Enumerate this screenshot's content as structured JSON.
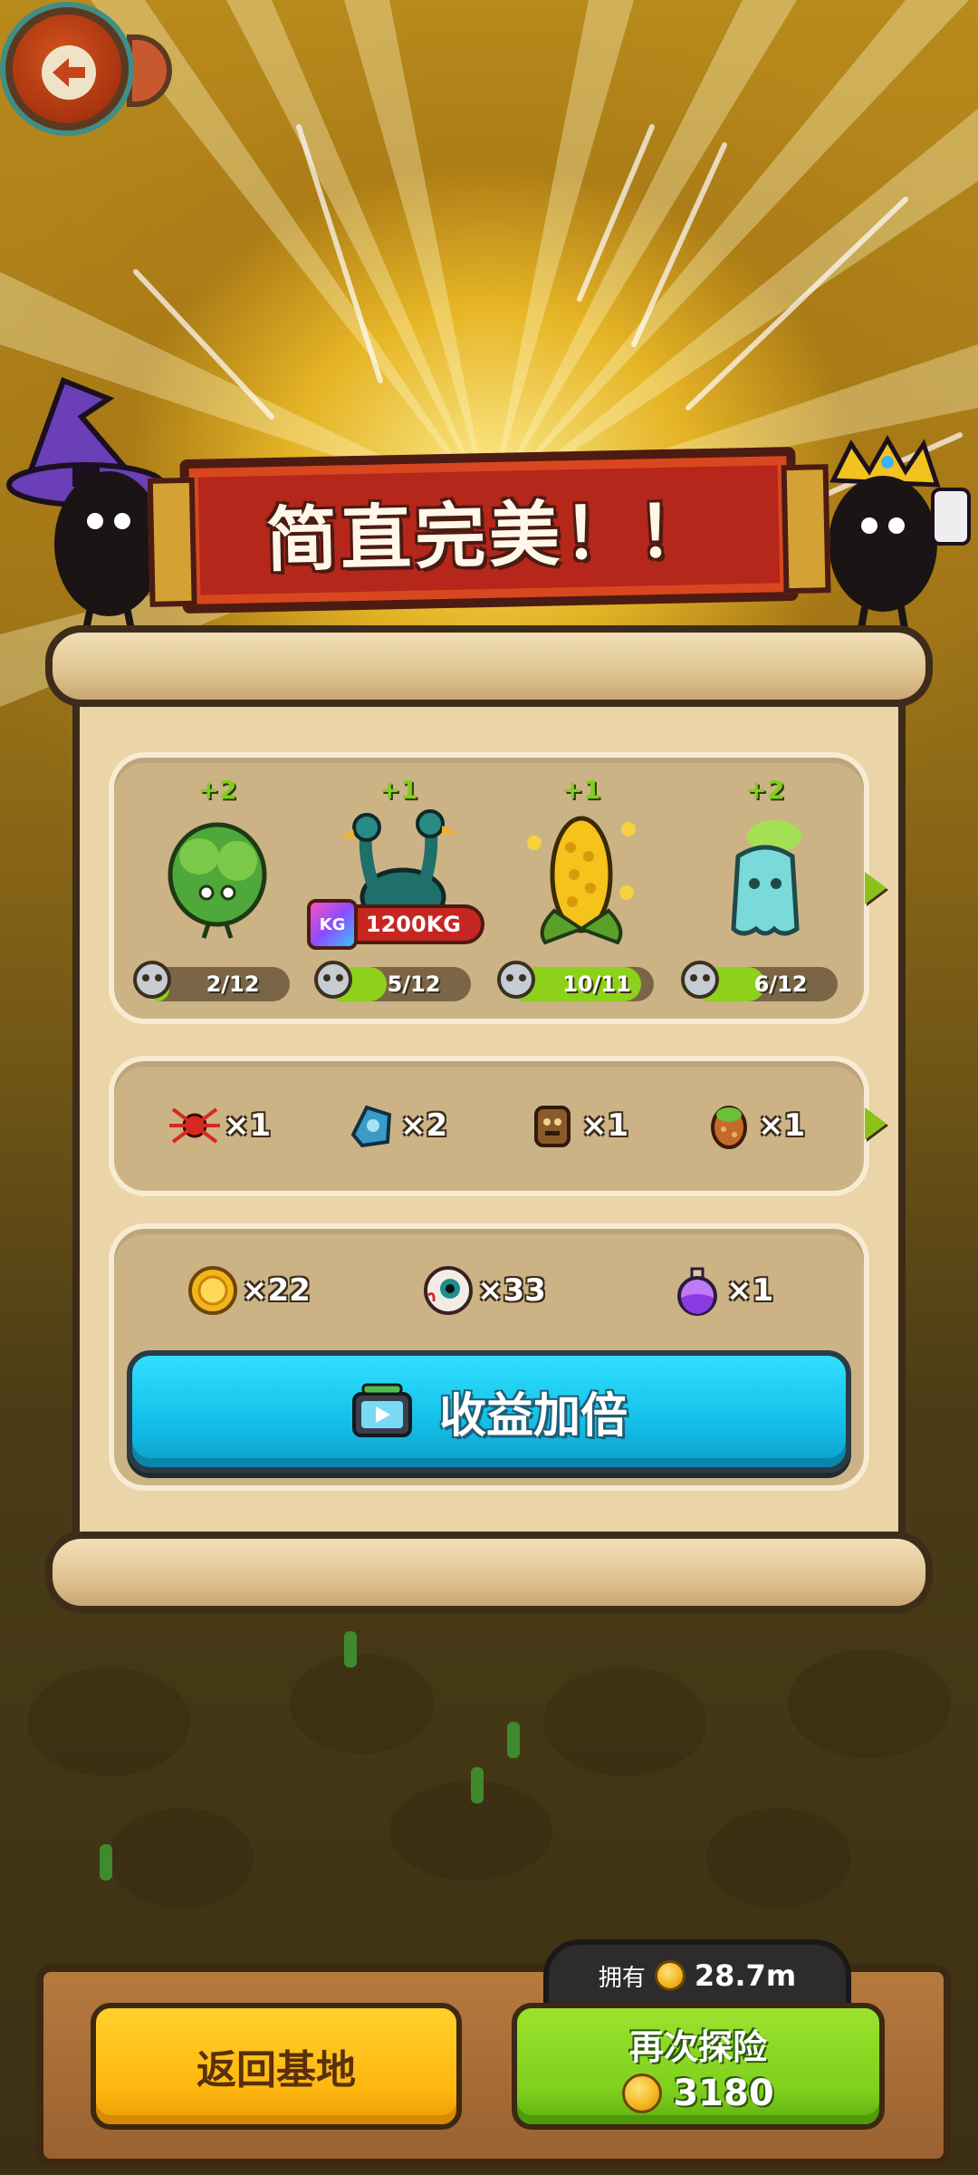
{
  "header": {
    "back_icon": "back-arrow-icon"
  },
  "banner": {
    "title": "简直完美！！"
  },
  "monsters": [
    {
      "plus": "+2",
      "name_icon": "lettuce-monster-icon",
      "progress": "2/12",
      "progress_fraction": 0.17
    },
    {
      "plus": "+1",
      "name_icon": "two-headed-ostrich-monster-icon",
      "progress": "5/12",
      "progress_fraction": 0.42,
      "weight": "1200KG",
      "weight_icon_text": "KG"
    },
    {
      "plus": "+1",
      "name_icon": "corn-monster-icon",
      "progress": "10/11",
      "progress_fraction": 0.91
    },
    {
      "plus": "+2",
      "name_icon": "ghost-radish-monster-icon",
      "progress": "6/12",
      "progress_fraction": 0.5
    }
  ],
  "items": [
    {
      "icon": "red-spider-icon",
      "count": "×1"
    },
    {
      "icon": "blue-relic-icon",
      "count": "×2"
    },
    {
      "icon": "totem-icon",
      "count": "×1"
    },
    {
      "icon": "egg-icon",
      "count": "×1"
    }
  ],
  "rewards": [
    {
      "icon": "coin-icon",
      "count": "×22"
    },
    {
      "icon": "eyeball-icon",
      "count": "×33"
    },
    {
      "icon": "potion-icon",
      "count": "×1"
    }
  ],
  "double_button": {
    "label": "收益加倍",
    "icon": "tv-ad-icon"
  },
  "bottom": {
    "owned_label": "拥有",
    "owned_value": "28.7m",
    "home_button": "返回基地",
    "again_button": "再次探险",
    "again_cost": "3180"
  },
  "colors": {
    "accent_green": "#7fd01d",
    "accent_blue": "#13bfe9",
    "accent_yellow": "#ffb70f",
    "banner_red": "#b5261b"
  }
}
